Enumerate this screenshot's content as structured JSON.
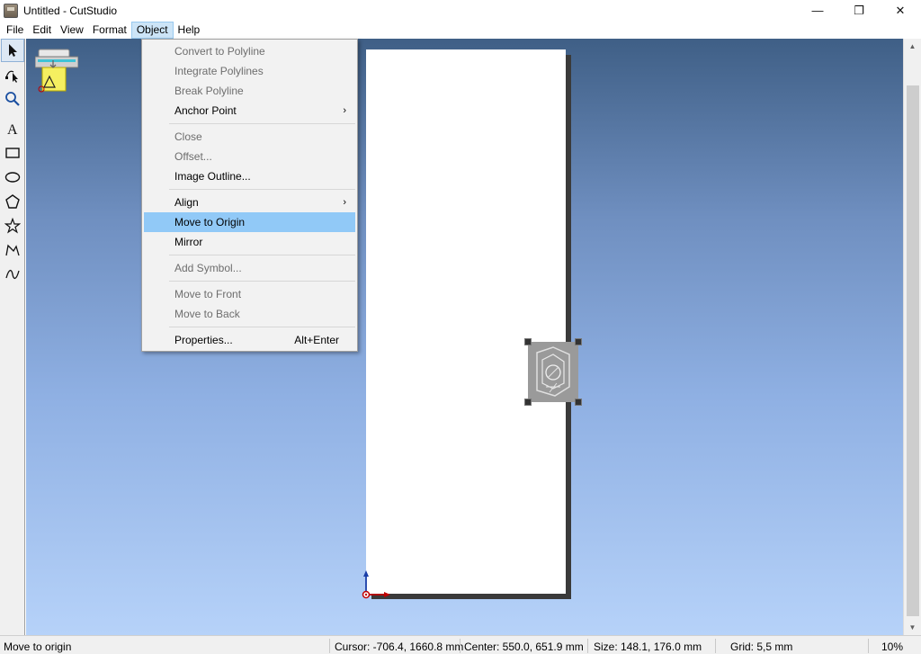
{
  "window": {
    "title": "Untitled - CutStudio",
    "minimize_glyph": "—",
    "restore_glyph": "❐",
    "close_glyph": "✕"
  },
  "menubar": {
    "items": [
      "File",
      "Edit",
      "View",
      "Format",
      "Object",
      "Help"
    ],
    "active": "Object"
  },
  "toolbar": {
    "tools": [
      "select-pointer-icon",
      "node-edit-icon",
      "zoom-icon",
      "text-icon",
      "rectangle-icon",
      "ellipse-icon",
      "polygon-icon",
      "star-icon",
      "polyline-icon",
      "curve-icon"
    ]
  },
  "object_menu": {
    "items": [
      {
        "label": "Convert to Polyline",
        "enabled": false
      },
      {
        "label": "Integrate Polylines",
        "enabled": false
      },
      {
        "label": "Break Polyline",
        "enabled": false
      },
      {
        "label": "Anchor Point",
        "enabled": true,
        "submenu": true
      },
      {
        "label": "Close",
        "enabled": false
      },
      {
        "label": "Offset...",
        "enabled": false
      },
      {
        "label": "Image Outline...",
        "enabled": true
      },
      {
        "label": "Align",
        "enabled": true,
        "submenu": true
      },
      {
        "label": "Move to Origin",
        "enabled": true,
        "highlighted": true
      },
      {
        "label": "Mirror",
        "enabled": true
      },
      {
        "label": "Add Symbol...",
        "enabled": false
      },
      {
        "label": "Move to Front",
        "enabled": false
      },
      {
        "label": "Move to Back",
        "enabled": false
      },
      {
        "label": "Properties...",
        "enabled": true,
        "shortcut": "Alt+Enter"
      }
    ],
    "submenu_glyph": "›"
  },
  "statusbar": {
    "message": "Move to origin",
    "cursor": "Cursor: -706.4, 1660.8 mm",
    "center": "Center: 550.0, 651.9 mm",
    "size": "Size: 148.1, 176.0 mm",
    "grid": "Grid: 5,5 mm",
    "zoom": "10%"
  },
  "colors": {
    "canvas_top": "#3f5f86",
    "canvas_bottom": "#b6d2f9",
    "menu_highlight": "#91c9f7",
    "origin_x_arrow": "#c00000",
    "origin_y_arrow": "#1a3ea8"
  }
}
